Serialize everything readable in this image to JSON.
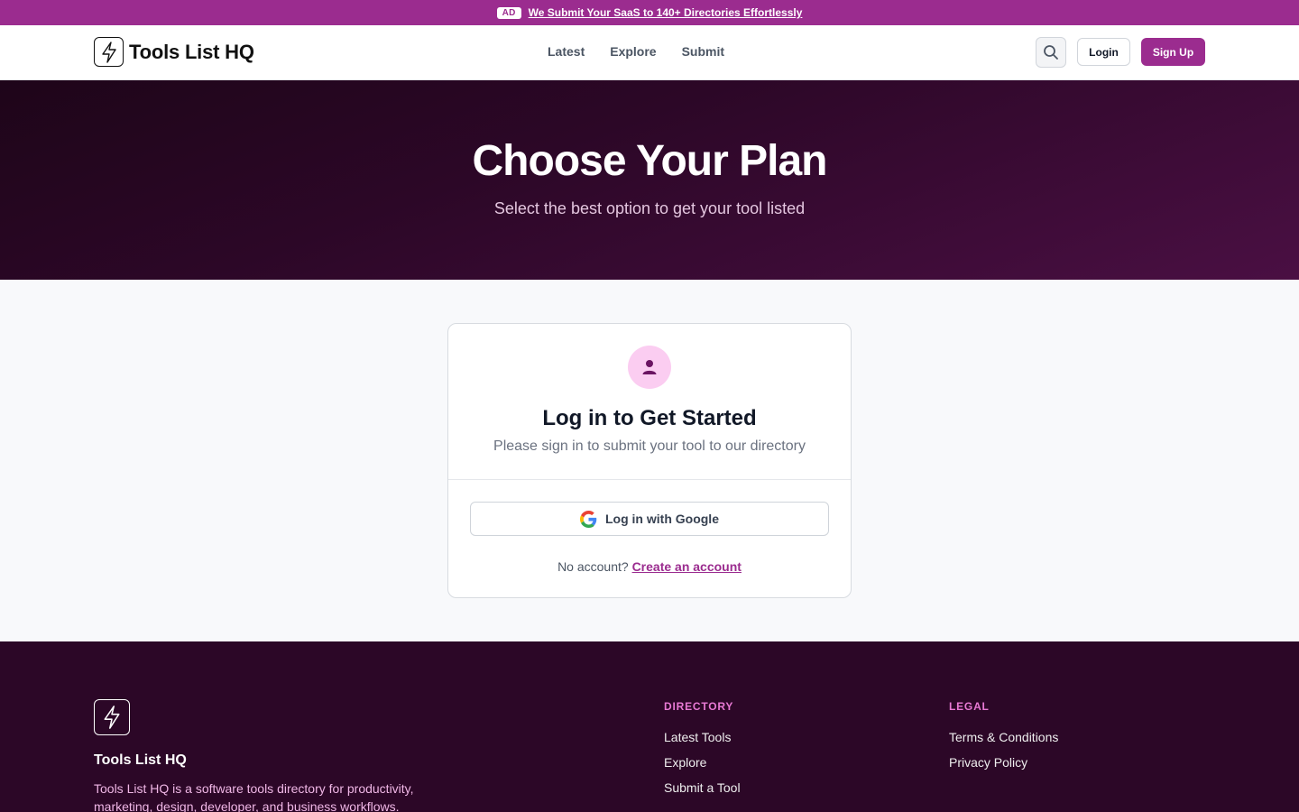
{
  "adbar": {
    "badge": "AD",
    "link": "We Submit Your SaaS to 140+ Directories Effortlessly"
  },
  "header": {
    "logo_text": "Tools List HQ",
    "nav": [
      "Latest",
      "Explore",
      "Submit"
    ],
    "login": "Login",
    "signup": "Sign Up"
  },
  "hero": {
    "title": "Choose Your Plan",
    "subtitle": "Select the best option to get your tool listed"
  },
  "card": {
    "title": "Log in to Get Started",
    "subtitle": "Please sign in to submit your tool to our directory",
    "google_button": "Log in with Google",
    "no_account": "No account?",
    "create_account": "Create an account"
  },
  "footer": {
    "name": "Tools List HQ",
    "description": "Tools List HQ is a software tools directory for productivity, marketing, design, developer, and business workflows.",
    "directory": {
      "heading": "DIRECTORY",
      "links": [
        "Latest Tools",
        "Explore",
        "Submit a Tool"
      ]
    },
    "legal": {
      "heading": "LEGAL",
      "links": [
        "Terms & Conditions",
        "Privacy Policy"
      ]
    }
  },
  "colors": {
    "brand": "#9b2c8f",
    "hero_dark": "#2c0727",
    "footer_bg": "#2c0727"
  },
  "icons": [
    "bolt-logo-icon",
    "search-icon",
    "user-icon",
    "google-icon"
  ]
}
